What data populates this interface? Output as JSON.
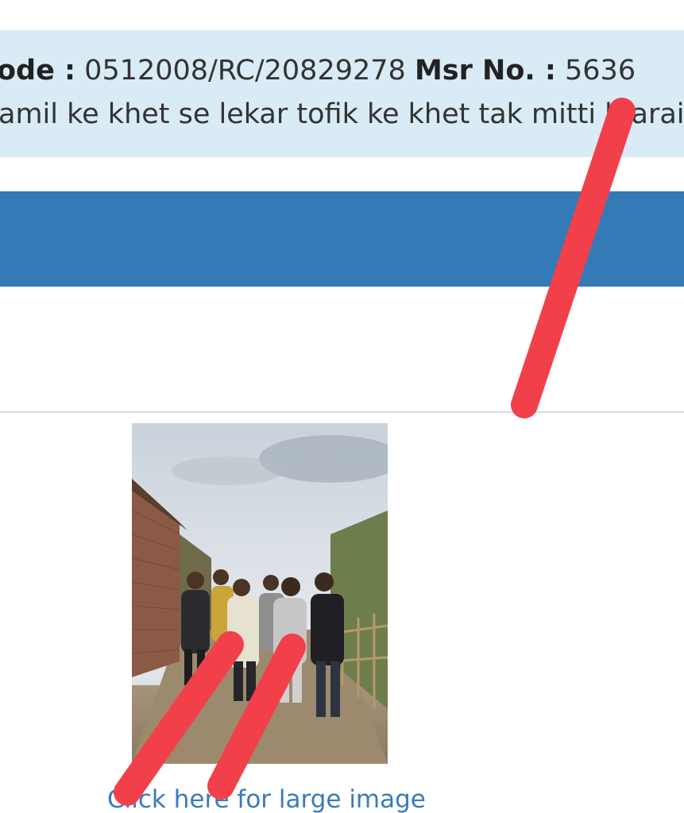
{
  "info": {
    "code_label": "ode :",
    "code_value": "0512008/RC/20829278",
    "msr_label": "Msr No. :",
    "msr_value": "5636",
    "description": "amil ke khet se lekar tofik ke khet tak mitti b  arai"
  },
  "photo": {
    "subject": "group photo of men standing on a dirt path between a brick wall and bamboo fence"
  },
  "link": {
    "large_image_label": "Click here for large image"
  },
  "colors": {
    "info_background": "#d9ebf5",
    "header_bar": "#337ab7",
    "link": "#3a7abf",
    "annotation_strokes": "#f2404a"
  }
}
